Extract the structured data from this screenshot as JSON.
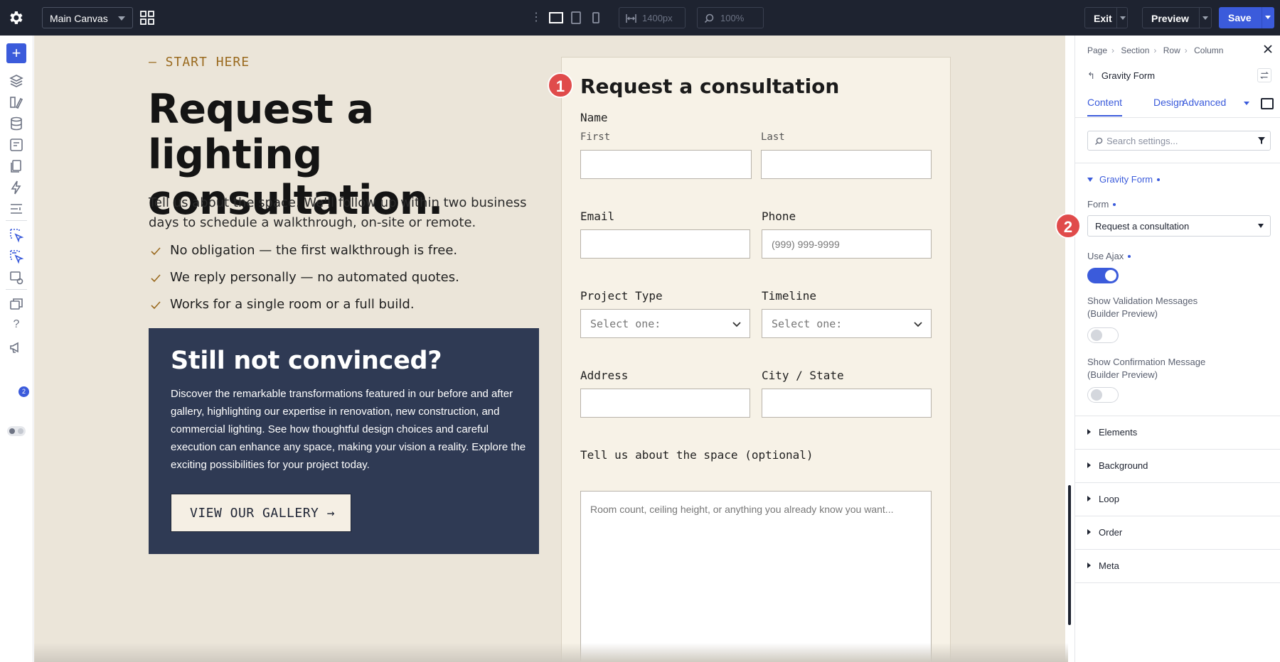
{
  "toolbar": {
    "canvas_select": "Main Canvas",
    "width_value": "1400px",
    "zoom_value": "100%",
    "exit_label": "Exit",
    "preview_label": "Preview",
    "save_label": "Save"
  },
  "rail": {
    "notification_count": "2"
  },
  "page": {
    "eyebrow": "— START HERE",
    "heading": "Request a lighting consultation.",
    "intro": "Tell us about the space. We'll follow up within two business days to schedule a walkthrough, on-site or remote.",
    "checklist": [
      "No obligation — the first walkthrough is free.",
      "We reply personally — no automated quotes.",
      "Works for a single room or a full build."
    ],
    "card": {
      "title": "Still not convinced?",
      "body": "Discover the remarkable transformations featured in our before and after gallery, highlighting our expertise in renovation, new construction, and commercial lighting. See how thoughtful design choices and careful execution can enhance any space, making your vision a reality. Explore the exciting possibilities for your project today.",
      "button": "VIEW OUR GALLERY →"
    }
  },
  "form": {
    "marker": "1",
    "title": "Request a consultation",
    "name_label": "Name",
    "first_label": "First",
    "last_label": "Last",
    "email_label": "Email",
    "phone_label": "Phone",
    "phone_placeholder": "(999) 999-9999",
    "project_type_label": "Project Type",
    "timeline_label": "Timeline",
    "select_placeholder": "Select one:",
    "address_label": "Address",
    "city_label": "City / State",
    "space_label": "Tell us about the space (optional)",
    "space_placeholder": "Room count, ceiling height, or anything you already know you want..."
  },
  "panel": {
    "breadcrumb": [
      "Page",
      "Section",
      "Row",
      "Column"
    ],
    "element_title": "Gravity Form",
    "tabs": [
      "Content",
      "Design",
      "Advanced"
    ],
    "search_placeholder": "Search settings...",
    "section_title": "Gravity Form",
    "form_label": "Form",
    "form_marker": "2",
    "form_value": "Request a consultation",
    "ajax_label": "Use Ajax",
    "ajax_on": true,
    "validation_label_1": "Show Validation Messages",
    "validation_label_2": "(Builder Preview)",
    "validation_on": false,
    "confirmation_label_1": "Show Confirmation Message",
    "confirmation_label_2": "(Builder Preview)",
    "confirmation_on": false,
    "collapsed_sections": [
      "Elements",
      "Background",
      "Loop",
      "Order",
      "Meta"
    ]
  },
  "colors": {
    "accent": "#3b5bdb",
    "topbar": "#1e2330",
    "canvas_bg": "#ebe5d9",
    "card_bg": "#2f3a54",
    "marker": "#e04b4b",
    "eyebrow": "#9a6a1f"
  }
}
